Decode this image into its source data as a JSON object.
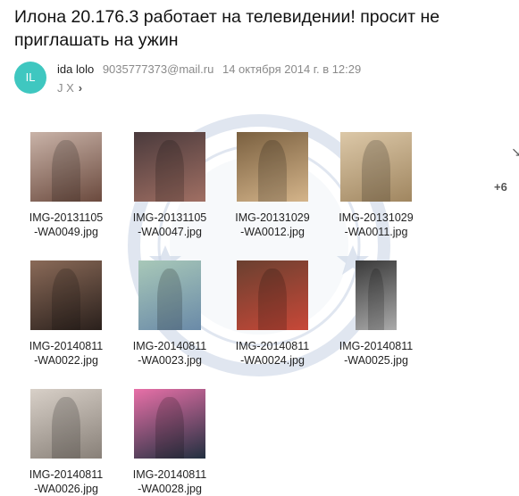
{
  "email": {
    "subject": "Илона 20.176.3 работает на телевидении! просит не приглашать на ужин",
    "avatar_initials": "IL",
    "sender_name": "ida lolo",
    "sender_email": "9035777373@mail.ru",
    "date": "14 октября 2014 г. в 12:29",
    "recipients": "J X",
    "recipients_chevron": "›"
  },
  "side": {
    "more_label": "+6",
    "arrow_glyph": "↘"
  },
  "attachments": [
    {
      "name": "IMG-20131105\n-WA0049.jpg",
      "thumb_colors": [
        "#c9b3a8",
        "#6b4a3e"
      ]
    },
    {
      "name": "IMG-20131105\n-WA0047.jpg",
      "thumb_colors": [
        "#4a3a3c",
        "#a06f63"
      ]
    },
    {
      "name": "IMG-20131029\n-WA0012.jpg",
      "thumb_colors": [
        "#7a6040",
        "#d4b48a"
      ]
    },
    {
      "name": "IMG-20131029\n-WA0011.jpg",
      "thumb_colors": [
        "#dcc8a8",
        "#a08660"
      ]
    },
    {
      "name": "IMG-20140811\n-WA0022.jpg",
      "thumb_colors": [
        "#8a6a58",
        "#2a201c"
      ]
    },
    {
      "name": "IMG-20140811\n-WA0023.jpg",
      "thumb_colors": [
        "#a8c8b8",
        "#6a8aa8"
      ]
    },
    {
      "name": "IMG-20140811\n-WA0024.jpg",
      "thumb_colors": [
        "#6a4030",
        "#c84838"
      ]
    },
    {
      "name": "IMG-20140811\n-WA0025.jpg",
      "thumb_colors": [
        "#3a3a3a",
        "#aaaaaa"
      ]
    },
    {
      "name": "IMG-20140811\n-WA0026.jpg",
      "thumb_colors": [
        "#d8d0c8",
        "#888078"
      ]
    },
    {
      "name": "IMG-20140811\n-WA0028.jpg",
      "thumb_colors": [
        "#e870a8",
        "#223040"
      ]
    }
  ]
}
